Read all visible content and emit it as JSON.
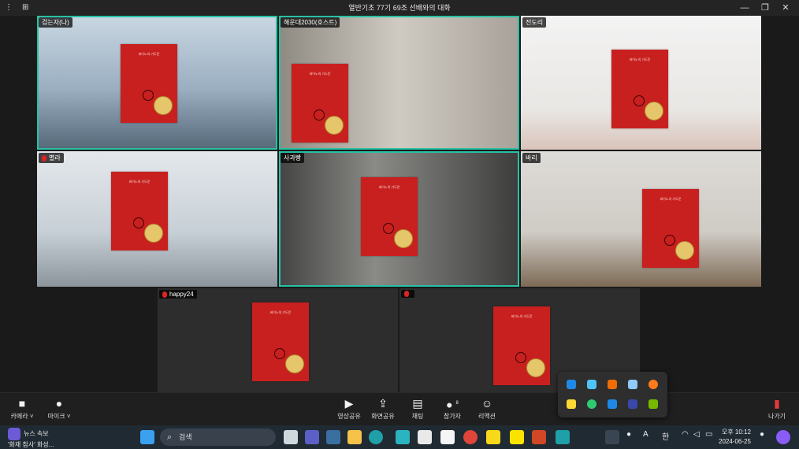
{
  "window": {
    "title": "열반기초 77기 69조 선배와의 대화"
  },
  "participants": [
    {
      "name": "검는자(나)",
      "active": true,
      "muted": false,
      "book": {
        "title": "싸이노의 기도문",
        "seal": "1000만 부 기념 개정 증보판"
      }
    },
    {
      "name": "해운대2030(호스트)",
      "active": true,
      "muted": false,
      "book": {
        "title": "싸이노의 기도문",
        "seal": "1000만 부 기념 개정 증보판"
      }
    },
    {
      "name": "전도리",
      "active": false,
      "muted": false,
      "book": {
        "title": "싸이노의 기도문",
        "seal": "1000만 부 기념 개정 증보판"
      }
    },
    {
      "name": "별라",
      "active": false,
      "muted": true,
      "book": {
        "title": "싸이노의 기도문",
        "seal": "1000만 부 기념 개정 증보판"
      }
    },
    {
      "name": "사과빵",
      "active": true,
      "muted": false,
      "book": {
        "title": "싸이노의 기도문",
        "seal": "1000만 부 기념 개정 증보판"
      }
    },
    {
      "name": "바리",
      "active": false,
      "muted": false,
      "book": {
        "title": "싸이노의 기도문",
        "seal": "1000만 부 기념 개정 증보판"
      }
    },
    {
      "name": "happy24",
      "active": false,
      "muted": true,
      "book": {
        "title": "싸이노의 기도문",
        "seal": "1000만 부 기념 개정 증보판"
      }
    },
    {
      "name": "",
      "active": false,
      "muted": true,
      "book": {
        "title": "싸이노의 기도문",
        "seal": "1000만 부 기념 개정 증보판"
      }
    }
  ],
  "toolbar": {
    "camera": "카메라",
    "mic": "마이크",
    "video_share": "영상공유",
    "screen_share": "화면공유",
    "chat": "채팅",
    "participants": "참가자",
    "participants_count": "8",
    "reactions": "리액션",
    "leave": "나가기"
  },
  "taskbar": {
    "news_title": "뉴스 속보",
    "news_sub": "'화재 참사' 화성...",
    "news_badge": "1",
    "search_placeholder": "검색",
    "ime": "A",
    "lang": "한",
    "time": "오후 10:12",
    "date": "2024-06-25"
  }
}
